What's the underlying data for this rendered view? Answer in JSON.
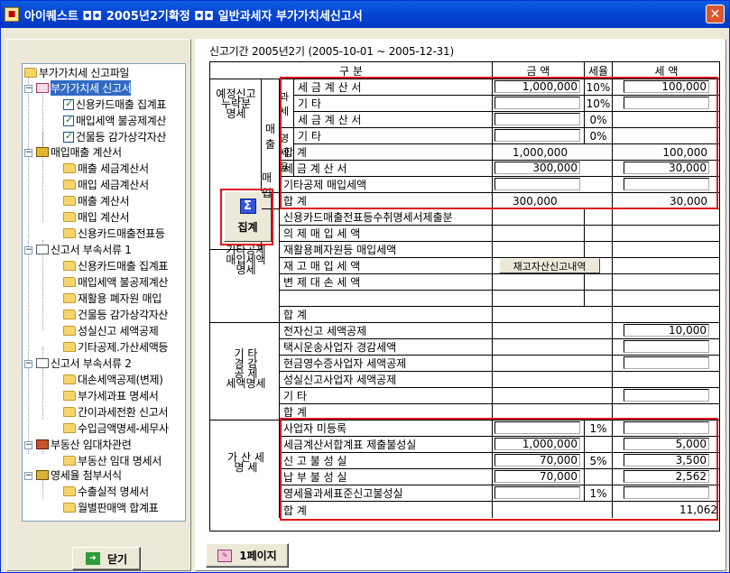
{
  "window": {
    "title": "아이퀘스트 ◘◘ 2005년2기확정 ◘◘ 일반과세자 부가가치세신고서",
    "close": "✕"
  },
  "tree": {
    "items": [
      {
        "label": "부가가치세 신고파일"
      },
      {
        "label": "부가가치세 신고서"
      },
      {
        "label": "신용카드매출 집계표"
      },
      {
        "label": "매입세액 불공제계산"
      },
      {
        "label": "건물등 감가상각자산"
      },
      {
        "label": "매입매출 계산서"
      },
      {
        "label": "매출 세금계산서"
      },
      {
        "label": "매입 세금계산서"
      },
      {
        "label": "매출 계산서"
      },
      {
        "label": "매입 계산서"
      },
      {
        "label": "신용카드매출전표등"
      },
      {
        "label": "신고서 부속서류 1"
      },
      {
        "label": "신용카드매출 집계표"
      },
      {
        "label": "매입세액 불공제계산"
      },
      {
        "label": "재활용 폐자원 매입"
      },
      {
        "label": "건물등 감가상각자산"
      },
      {
        "label": "성실신고 세액공제"
      },
      {
        "label": "기타공제.가산세액등"
      },
      {
        "label": "신고서 부속서류 2"
      },
      {
        "label": "대손세액공제(변제)"
      },
      {
        "label": "부가세과표 명세서"
      },
      {
        "label": "간이과세전환 신고서"
      },
      {
        "label": "수입금액명세-세무사"
      },
      {
        "label": "부동산 임대차관련"
      },
      {
        "label": "부동산 임대 명세서"
      },
      {
        "label": "영세율 첨부서식"
      },
      {
        "label": "수출실적 명세서"
      },
      {
        "label": "월별판매액 합계표"
      }
    ],
    "close_button": "닫기"
  },
  "form": {
    "period": "신고기간 2005년2기 (2005-10-01 ~ 2005-12-31)",
    "headers": {
      "category": "구 분",
      "amount": "금 액",
      "rate": "세율",
      "tax": "세 액"
    },
    "section1": {
      "label_v1": "예정신고",
      "label_v2": "누락분",
      "label_v3": "명세"
    },
    "sales_label": "매출",
    "taxable_label": "과세",
    "zero_label": "영세율",
    "purchase_label": "매입",
    "tally_button": "집계",
    "rows_sales": [
      {
        "label": "세 금 계 산 서",
        "amount": "1,000,000",
        "rate": "10%",
        "tax": "100,000"
      },
      {
        "label": "기 타",
        "amount": "",
        "rate": "10%",
        "tax": ""
      },
      {
        "label": "세 금 계 산 서",
        "amount": "",
        "rate": "0%",
        "tax": ""
      },
      {
        "label": "기 타",
        "amount": "",
        "rate": "0%",
        "tax": ""
      }
    ],
    "sales_total": {
      "label": "합 계",
      "amount": "1,000,000",
      "tax": "100,000"
    },
    "rows_purchase": [
      {
        "label": "세 금 계 산 서",
        "amount": "300,000",
        "tax": "30,000"
      },
      {
        "label": "기타공제 매입세액",
        "amount": "",
        "tax": ""
      }
    ],
    "purchase_total": {
      "label": "합 계",
      "amount": "300,000",
      "tax": "30,000"
    },
    "section2": {
      "label_a": "기타공제",
      "label_b": "매입세액",
      "label_c": "명세"
    },
    "rows_other": [
      {
        "label": "신용카드매출전표등수취명세서제출분"
      },
      {
        "label": "의 제 매 입 세 액"
      },
      {
        "label": "재활용폐자원등 매입세액"
      },
      {
        "label": "재 고 매 입 세 액"
      },
      {
        "label": "변 제 대 손 세 액"
      },
      {
        "label": ""
      },
      {
        "label": "합 계"
      }
    ],
    "inventory_button": "재고자산신고내역",
    "section3": {
      "label_a": "기 타",
      "label_b": "경 감",
      "label_c": "공 제",
      "label_d": "세액명세"
    },
    "rows_reduction": [
      {
        "label": "전자신고 세액공제",
        "tax": "10,000"
      },
      {
        "label": "택시운송사업자 경감세액",
        "tax": ""
      },
      {
        "label": "현금영수증사업자 세액공제",
        "tax": ""
      },
      {
        "label": "성실신고사업자 세액공제",
        "tax": ""
      },
      {
        "label": "기 타",
        "tax": ""
      },
      {
        "label": "합 계",
        "tax": ""
      }
    ],
    "section4": {
      "label_a": "가 산 세",
      "label_b": "명 세"
    },
    "rows_penalty": [
      {
        "label": "사업자 미등록",
        "amount": "",
        "rate": "1%",
        "tax": ""
      },
      {
        "label": "세금계산서합계표 제출불성실",
        "amount": "1,000,000",
        "rate": "",
        "tax": "5,000"
      },
      {
        "label": "신 고 불 성 실",
        "amount": "70,000",
        "rate": "5%",
        "tax": "3,500"
      },
      {
        "label": "납 부 불 성 실",
        "amount": "70,000",
        "rate": "",
        "tax": "2,562"
      },
      {
        "label": "영세율과세표준신고불성실",
        "amount": "",
        "rate": "1%",
        "tax": ""
      },
      {
        "label": "합 계",
        "amount": "",
        "rate": "",
        "tax": "11,062"
      }
    ],
    "page_button": "1페이지"
  }
}
